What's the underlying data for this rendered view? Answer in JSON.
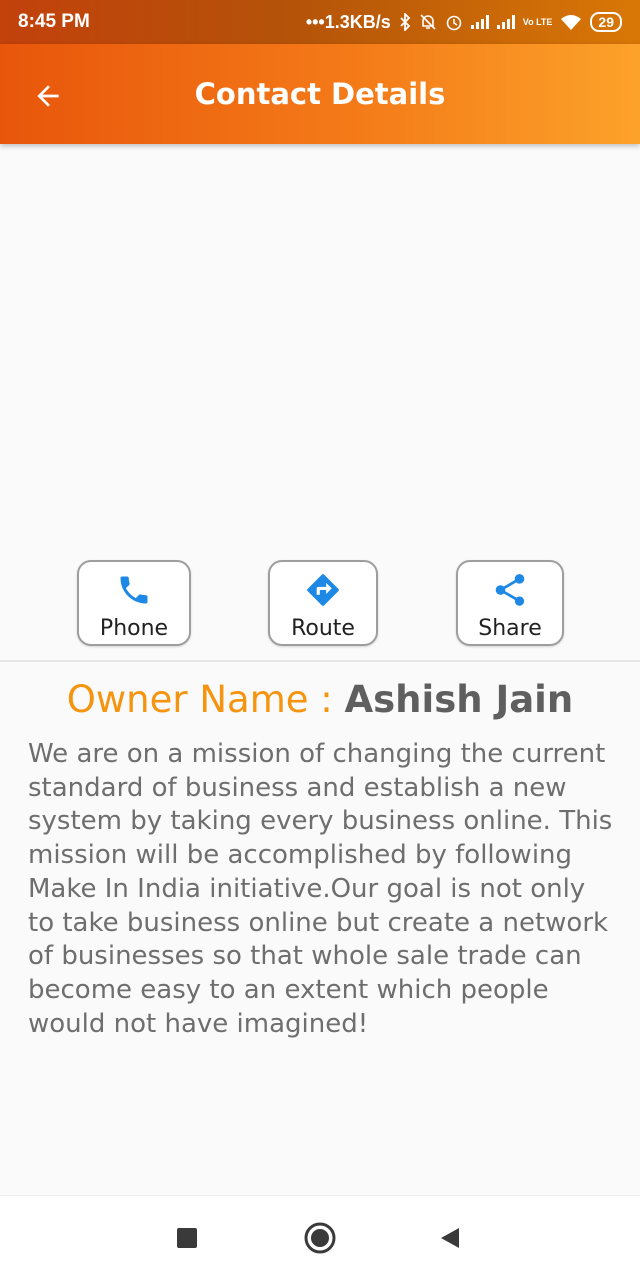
{
  "status_bar": {
    "time": "8:45 PM",
    "network_speed": "•••1.3KB/s",
    "volte": "Vo LTE",
    "battery": "29"
  },
  "app_bar": {
    "title": "Contact Details",
    "back_icon": "arrow-left-icon"
  },
  "actions": [
    {
      "label": "Phone",
      "icon": "phone-icon",
      "color": "#1e88e5"
    },
    {
      "label": "Route",
      "icon": "directions-icon",
      "color": "#1e88e5"
    },
    {
      "label": "Share",
      "icon": "share-icon",
      "color": "#1e88e5"
    }
  ],
  "owner": {
    "label": "Owner Name : ",
    "name": "Ashish Jain"
  },
  "description": "We are on a mission of changing the current standard of business and establish a new system by taking every business online. This mission will be accomplished by following Make In India initiative.Our goal is not only to take business online but create a network of businesses so that whole sale trade can become easy to an extent which people would not have imagined!",
  "nav_bar": {
    "recents_icon": "square-icon",
    "home_icon": "circle-icon",
    "back_icon": "triangle-back-icon"
  },
  "colors": {
    "accent": "#f5940f",
    "appbar_start": "#e8560b",
    "appbar_end": "#fca22a",
    "icon_blue": "#1e88e5"
  }
}
